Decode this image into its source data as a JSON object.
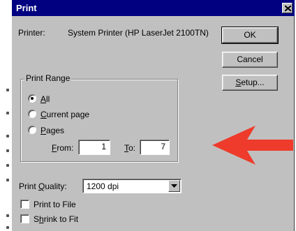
{
  "dialog": {
    "title": "Print",
    "printer_label": "Printer:",
    "printer_value": "System Printer (HP LaserJet 2100TN)"
  },
  "buttons": {
    "ok": "OK",
    "cancel": "Cancel",
    "setup_first": "S",
    "setup_rest": "etup..."
  },
  "print_range": {
    "title": "Print Range",
    "options": [
      {
        "underlined": "A",
        "rest": "ll",
        "selected": true
      },
      {
        "underlined": "C",
        "rest": "urrent page",
        "selected": false
      },
      {
        "underlined": "P",
        "rest": "ages",
        "selected": false
      }
    ],
    "from_underlined": "F",
    "from_rest": "rom:",
    "from_value": "1",
    "to_underlined": "T",
    "to_rest": "o:",
    "to_value": "7"
  },
  "print_quality": {
    "label_pre": "Print ",
    "label_underlined": "Q",
    "label_post": "uality:",
    "value": "1200 dpi"
  },
  "checkboxes": {
    "print_to_file": {
      "label": "Print to File",
      "checked": false
    },
    "shrink_to_fit": {
      "pre": "S",
      "underlined": "h",
      "post": "rink to Fit",
      "checked": false
    }
  },
  "colors": {
    "titlebar": "#000080",
    "dialog_face": "#c0c0c0",
    "annotation_arrow": "#ee3b2b"
  },
  "icons": {
    "close": "close-icon",
    "dropdown": "chevron-down-icon",
    "annotation": "arrow-left-icon"
  }
}
